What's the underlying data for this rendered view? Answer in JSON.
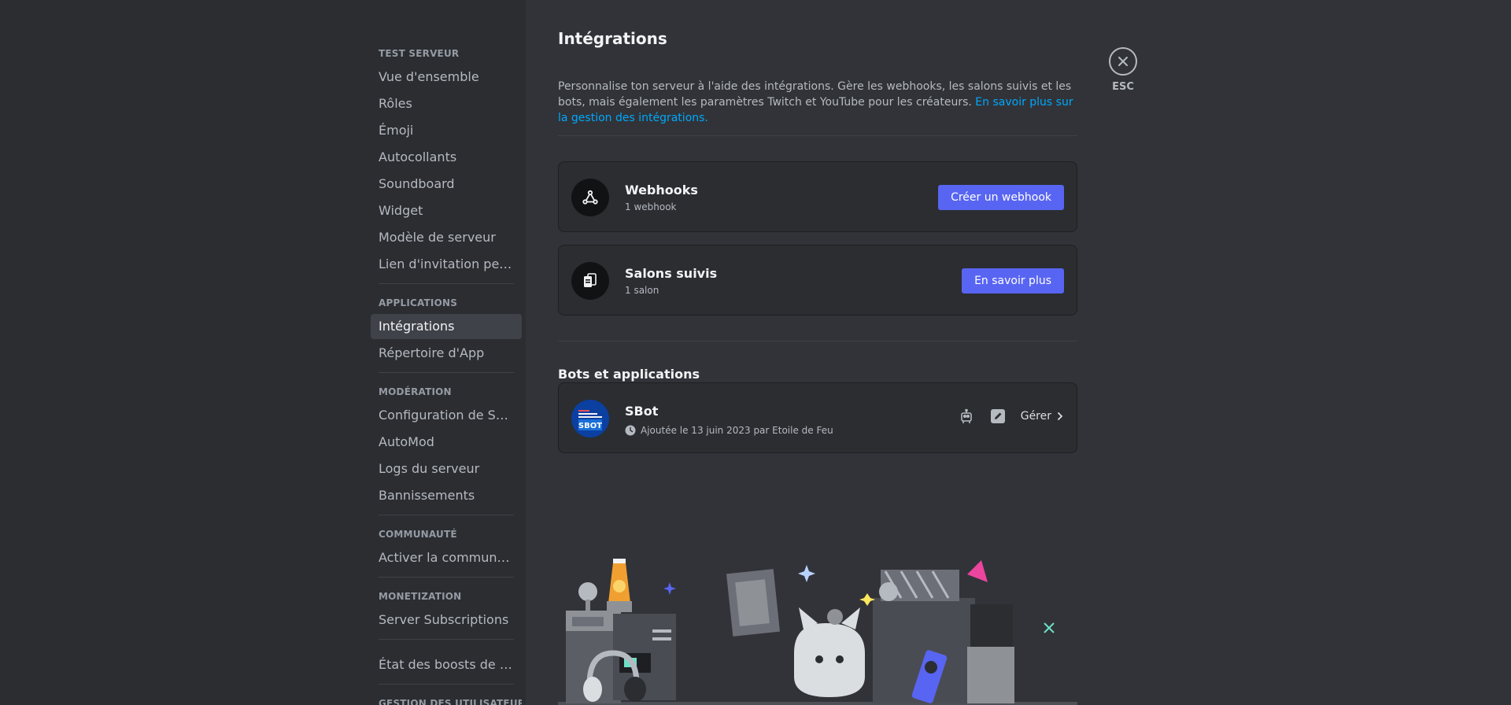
{
  "sidebar": {
    "sections": [
      {
        "header": "TEST SERVEUR",
        "items": [
          "Vue d'ensemble",
          "Rôles",
          "Émoji",
          "Autocollants",
          "Soundboard",
          "Widget",
          "Modèle de serveur",
          "Lien d'invitation perso..."
        ]
      },
      {
        "header": "APPLICATIONS",
        "items": [
          "Intégrations",
          "Répertoire d'App"
        ],
        "active": "Intégrations"
      },
      {
        "header": "MODÉRATION",
        "items": [
          "Configuration de Sécur...",
          "AutoMod",
          "Logs du serveur",
          "Bannissements"
        ]
      },
      {
        "header": "COMMUNAUTÉ",
        "items": [
          "Activer la communauté"
        ]
      },
      {
        "header": "MONETIZATION",
        "items": [
          "Server Subscriptions"
        ]
      },
      {
        "header": "",
        "items": [
          "État des boosts de serveur"
        ]
      },
      {
        "header": "GESTION DES UTILISATEURS",
        "items": []
      }
    ]
  },
  "page": {
    "title": "Intégrations",
    "description": "Personnalise ton serveur à l'aide des intégrations. Gère les webhooks, les salons suivis et les bots, mais également les paramètres Twitch et YouTube pour les créateurs.",
    "link": "En savoir plus sur la gestion des intégrations."
  },
  "webhooks": {
    "title": "Webhooks",
    "subtitle": "1 webhook",
    "button": "Créer un webhook",
    "icon": "webhook-icon"
  },
  "followed": {
    "title": "Salons suivis",
    "subtitle": "1 salon",
    "button": "En savoir plus",
    "icon": "followed-channel-icon"
  },
  "bots": {
    "section_title": "Bots et applications",
    "items": [
      {
        "name": "SBot",
        "avatar_text": "SBOT",
        "meta": "Ajoutée le 13 juin 2023 par Etoile de Feu",
        "manage_label": "Gérer"
      }
    ]
  },
  "close": {
    "label": "ESC"
  },
  "colors": {
    "accent": "#5865f2",
    "link": "#00a8fc",
    "background": "#313338",
    "sidebar": "#2b2d31"
  }
}
